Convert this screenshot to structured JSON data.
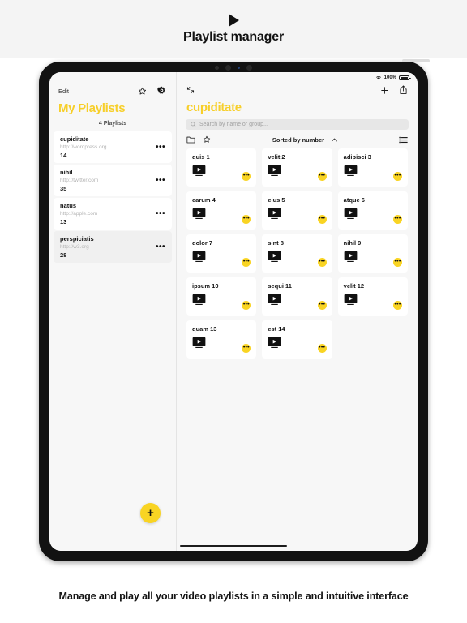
{
  "promo": {
    "play_icon": "play-triangle-icon",
    "title": "Playlist manager",
    "caption": "Manage and play all your video playlists in a simple and intuitive interface"
  },
  "statusbar": {
    "wifi_icon": "wifi-icon",
    "battery_percent": "100%",
    "battery_icon": "battery-full-icon"
  },
  "sidebar": {
    "edit_label": "Edit",
    "star_icon": "star-outline-icon",
    "gear_icon": "gear-icon",
    "title": "My Playlists",
    "count_label": "4 Playlists",
    "add_button_icon": "plus-icon",
    "items": [
      {
        "name": "cupiditate",
        "url": "http://wordpress.org",
        "count": "14",
        "more_icon": "ellipsis-icon",
        "selected": false
      },
      {
        "name": "nihil",
        "url": "http://twitter.com",
        "count": "35",
        "more_icon": "ellipsis-icon",
        "selected": false
      },
      {
        "name": "natus",
        "url": "http://apple.com",
        "count": "13",
        "more_icon": "ellipsis-icon",
        "selected": false
      },
      {
        "name": "perspiciatis",
        "url": "http://w3.org",
        "count": "28",
        "more_icon": "ellipsis-icon",
        "selected": true
      }
    ]
  },
  "detail": {
    "collapse_icon": "collapse-arrows-icon",
    "add_icon": "plus-icon",
    "share_icon": "share-icon",
    "title": "cupiditate",
    "search": {
      "icon": "search-icon",
      "placeholder": "Search by name or group..."
    },
    "toolbar": {
      "folder_icon": "folder-icon",
      "star_icon": "star-outline-icon",
      "sort_label": "Sorted by number",
      "sort_chevron_icon": "chevron-up-icon",
      "list_view_icon": "list-view-icon"
    },
    "videos": [
      {
        "title": "quis 1",
        "icon": "monitor-play-icon",
        "badge_icon": "ellipsis-icon"
      },
      {
        "title": "velit 2",
        "icon": "monitor-play-icon",
        "badge_icon": "ellipsis-icon"
      },
      {
        "title": "adipisci 3",
        "icon": "monitor-play-icon",
        "badge_icon": "ellipsis-icon"
      },
      {
        "title": "earum 4",
        "icon": "monitor-play-icon",
        "badge_icon": "ellipsis-icon"
      },
      {
        "title": "eius 5",
        "icon": "monitor-play-icon",
        "badge_icon": "ellipsis-icon"
      },
      {
        "title": "atque 6",
        "icon": "monitor-play-icon",
        "badge_icon": "ellipsis-icon"
      },
      {
        "title": "dolor 7",
        "icon": "monitor-play-icon",
        "badge_icon": "ellipsis-icon"
      },
      {
        "title": "sint 8",
        "icon": "monitor-play-icon",
        "badge_icon": "ellipsis-icon"
      },
      {
        "title": "nihil 9",
        "icon": "monitor-play-icon",
        "badge_icon": "ellipsis-icon"
      },
      {
        "title": "ipsum 10",
        "icon": "monitor-play-icon",
        "badge_icon": "ellipsis-icon"
      },
      {
        "title": "sequi 11",
        "icon": "monitor-play-icon",
        "badge_icon": "ellipsis-icon"
      },
      {
        "title": "velit 12",
        "icon": "monitor-play-icon",
        "badge_icon": "ellipsis-icon"
      },
      {
        "title": "quam 13",
        "icon": "monitor-play-icon",
        "badge_icon": "ellipsis-icon"
      },
      {
        "title": "est 14",
        "icon": "monitor-play-icon",
        "badge_icon": "ellipsis-icon"
      }
    ]
  },
  "colors": {
    "accent_yellow": "#f9d423",
    "title_yellow": "#f7cf2a",
    "text_dark": "#121212",
    "page_bg": "#f7f7f7"
  }
}
